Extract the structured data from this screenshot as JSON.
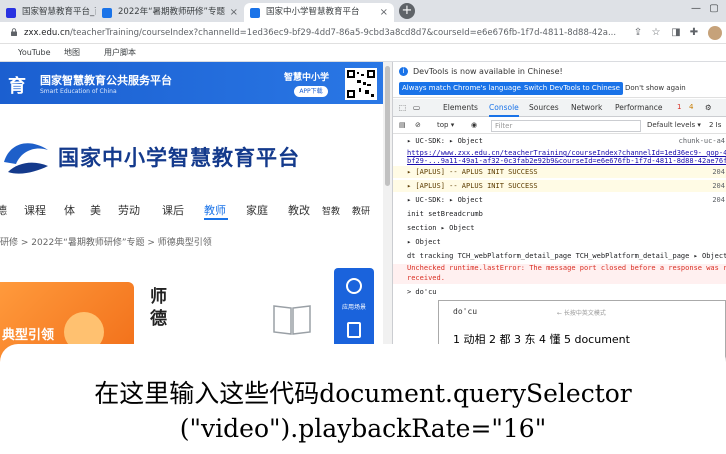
{
  "tabs": [
    {
      "title": "国家智慧教育平台_百度搜索",
      "close": "×"
    },
    {
      "title": "2022年“暑期教师研修”专题",
      "close": "×"
    },
    {
      "title": "国家中小学智慧教育平台",
      "close": "×"
    }
  ],
  "new_tab": "+",
  "window_controls": [
    "—",
    "▢"
  ],
  "address": {
    "host": "zxx.edu.cn",
    "path": "/teacherTraining/courseIndex?channelId=1ed36ec9-bf29-4dd7-86a5-9cbd3a8cd8d7&courseId=e6e676fb-1f7d-4811-8d88-42a..."
  },
  "bookmarks": [
    {
      "label": "YouTube",
      "color": "#ff0000"
    },
    {
      "label": "地图",
      "color": "#34a853"
    },
    {
      "label": "用户脚本",
      "color": "#5f6368"
    }
  ],
  "page": {
    "banner_logo": "育",
    "banner_title": "国家智慧教育公共服务平台",
    "banner_subtitle": "Smart Education of China",
    "banner_app": "智慧中小学",
    "banner_app_button": "APP下载",
    "site_title": "国家中小学智慧教育平台",
    "nav": [
      "德",
      "课程",
      "体",
      "美",
      "劳动",
      "课后",
      "教师",
      "家庭",
      "教改",
      "智教",
      "教研"
    ],
    "nav_active_index": 6,
    "breadcrumb": "研修 > 2022年“暑期教师研修”专题 > 师德典型引领",
    "card_label": "典型引领",
    "title_right_line1": "师",
    "title_right_line2": "德",
    "side_float_label": "应用场景"
  },
  "devtools": {
    "notice": "DevTools is now available in Chinese!",
    "btn_match": "Always match Chrome's language",
    "btn_switch": "Switch DevTools to Chinese",
    "link_dont": "Don't show again",
    "tabs": [
      "Elements",
      "Console",
      "Sources",
      "Network",
      "Performance"
    ],
    "active_tab_index": 1,
    "badge_errors": "1",
    "badge_warnings": "4",
    "context": "top ▾",
    "filter_placeholder": "Filter",
    "levels": "Default levels ▾",
    "issues": "2 Is",
    "console_lines": [
      {
        "text": "▸ UC-SDK:  ▸ Object",
        "src": "chunk-uc-a4"
      },
      {
        "text": "https://www.zxx.edu.cn/teacherTraining/courseIndex?channelId=1ed36ec9- gop-4d",
        "src": "",
        "link": true
      },
      {
        "text": "bf29-...9a11-49a1-af32-0c3fab2e92b9&courseId=e6e676fb-1f7d-4811-8d88-42ae76fde",
        "src": "",
        "link": true
      },
      {
        "text": "▸ [APLUS] -- APLUS INIT SUCCESS",
        "src": "204",
        "kind": "warn"
      },
      {
        "text": "▸ [APLUS] -- APLUS INIT SUCCESS",
        "src": "204",
        "kind": "warn"
      },
      {
        "text": "▸ UC-SDK:  ▸ Object",
        "src": "204"
      },
      {
        "text": "init setBreadcrumb",
        "src": ""
      },
      {
        "text": "section  ▸ Object",
        "src": ""
      },
      {
        "text": "  ▸ Object",
        "src": ""
      },
      {
        "text": "dt tracking TCH_webPlatform_detail_page TCH_webPlatform_detail_page ▸ Object",
        "src": ""
      },
      {
        "text": "Unchecked runtime.lastError: The message port closed before a response was re",
        "src": "",
        "kind": "err"
      },
      {
        "text": "received.",
        "src": "",
        "kind": "err"
      },
      {
        "text": "> do'cu",
        "src": ""
      }
    ],
    "suggest_input": "do'cu",
    "suggest_hint": "← 长按中英文模式",
    "suggest_list": "1 动相  2 都  3 东  4 懂  5 document"
  },
  "subtitle": {
    "line1": "在这里输入这些代码document.querySelector",
    "line2": "(\"video\").playbackRate=\"16\""
  }
}
